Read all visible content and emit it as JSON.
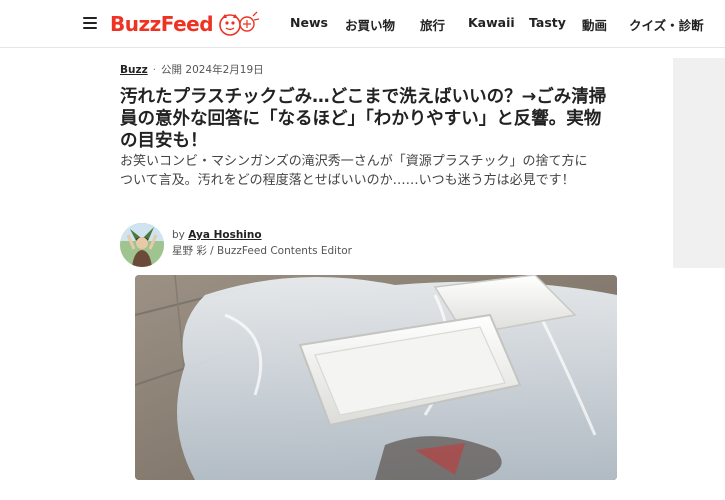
{
  "header": {
    "logo_text": "BuzzFeed",
    "nav": [
      {
        "label": "News"
      },
      {
        "label": "お買い物"
      },
      {
        "label": "旅行"
      },
      {
        "label": "Kawaii"
      },
      {
        "label": "Tasty"
      },
      {
        "label": "動画"
      },
      {
        "label": "クイズ・診断"
      }
    ]
  },
  "article": {
    "category": "Buzz",
    "published": "公開 2024年2月19日",
    "title": "汚れたプラスチックごみ…どこまで洗えばいいの？→ごみ清掃員の意外な回答に「なるほど」「わかりやすい」と反響。実物の目安も！",
    "description": "お笑いコンビ・マシンガンズの滝沢秀一さんが「資源プラスチック」の捨て方について言及。汚れをどの程度落とせばいいのか……いつも迷う方は必見です！",
    "byline": {
      "by": "by",
      "author": "Aya Hoshino",
      "role": "星野 彩 / BuzzFeed Contents Editor"
    }
  },
  "colors": {
    "brand": "#ee3322",
    "text": "#222222",
    "muted": "#555555"
  }
}
